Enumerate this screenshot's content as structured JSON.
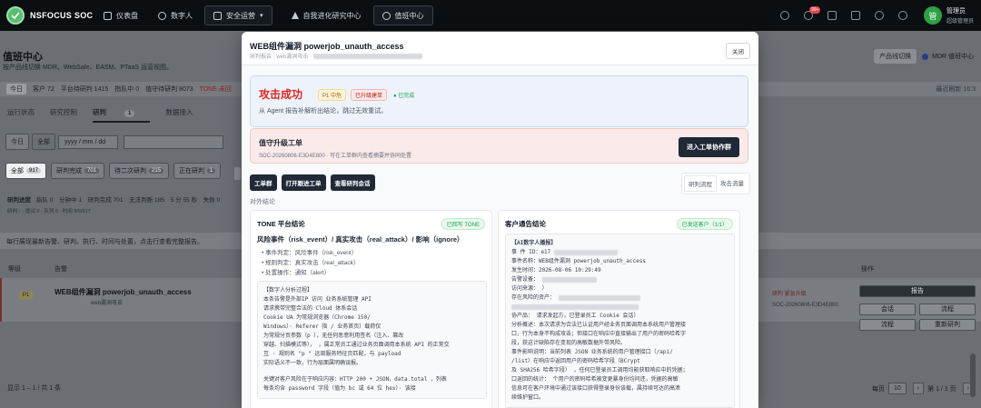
{
  "topbar": {
    "brand": "NSFOCUS SOC",
    "nav": [
      {
        "label": "仪表盘"
      },
      {
        "label": "数字人"
      },
      {
        "label": "安全运营"
      },
      {
        "label": "自我进化研究中心"
      },
      {
        "label": "值班中心"
      }
    ],
    "notification_count": "99+",
    "user_name": "管理员",
    "user_role": "超级管理员",
    "avatar_initial": "管"
  },
  "background": {
    "title": "值班中心",
    "subtitle": "按产品线切换 MDR、WebSafe、EASM、PTaaS 运营视图。",
    "product_switch_label": "产品线切换",
    "product_current": "MDR 值班中心",
    "stats": [
      "今日",
      "客户 72",
      "平台待研判 1415",
      "指队中 0",
      "值守待研判 8073",
      "TONE 未回"
    ],
    "last_refresh": "最近刷新 16:3",
    "tabs": [
      "运行状态",
      "研究控制",
      "研判",
      "数据接入"
    ],
    "tab_pill": "1",
    "filter_today": "今日",
    "filter_all": "全部",
    "date_placeholder": "yyyy / mm / dd",
    "segments": [
      {
        "label": "全部",
        "count": "917"
      },
      {
        "label": "研判完成",
        "count": "701"
      },
      {
        "label": "待二次研判",
        "count": "215"
      },
      {
        "label": "正在研判",
        "count": "1"
      }
    ],
    "progress_label": "研判进度",
    "progress_items": [
      "指队 0",
      "分钟中 1",
      "研判完成 701",
      "无法判断 185",
      "5 分 55 秒",
      "失败 0"
    ],
    "progress_sub": "研判 ↑ : 提试 0 · 队列 0 · 时间 9/6/917",
    "hint": "每行展现最新告警、研判、执行、时间与处置，点击行查看完整报告。",
    "table_headers": [
      "等级",
      "告警",
      "操作"
    ],
    "row": {
      "level": "P1",
      "title": "WEB组件漏洞 powerjob_unauth_access",
      "sub": "web漏洞攻击",
      "tag": "研判 紧急升级",
      "code": "SOC-20260806-E3D4E800"
    },
    "row_actions": [
      "报告",
      "会话",
      "流程",
      "流程",
      "重新研判"
    ],
    "pager_left": "显示 1 – 1 / 共 1 条",
    "pager_label": "每页",
    "page_size": "10",
    "page_info": "第 1 / 1 页"
  },
  "modal": {
    "title": "WEB组件漏洞 powerjob_unauth_access",
    "breadcrumb": "研判报告 · web漏洞攻击 ·",
    "close": "关闭",
    "result_title": "攻击成功",
    "tag_priority": "P1 中危",
    "tag_upgrade": "已升级建单",
    "tag_done": "● 已完成",
    "result_desc": "从 Agent 报告补解析出结论，跳过无效重试。",
    "ticket_title": "值守升级工单",
    "ticket_sub": "SOC-20260806-E3D4E800 · 可在工单群内查看摘要并协同处置",
    "ticket_button": "进入工单协作群",
    "action_buttons": [
      "工单群",
      "打开跟进工单",
      "查看研判会话"
    ],
    "view_tabs": [
      "研判流程",
      "攻击流量"
    ],
    "conclusion_label": "对外结论",
    "tone": {
      "title": "TONE 平台结论",
      "badge": "已回写 TONE",
      "headline": "风险事件（risk_event）/ 真实攻击（real_attack）/ 影响（ignore）",
      "bullets": [
        "事件判定：风险事件（risk_event）",
        "规则判定：真实攻击（real_attack）",
        "处置操作：通知（alert）"
      ],
      "analysis": [
        "【数字人分析过程】",
        "本条告警是外部IP        访问         业务系统管理 API",
        "          请求携带完整合法的          Cloud 体系会话",
        "Cookie          UA 为常规浏览器（Chrome 150/",
        "Windows）· Referer 指           / 业务首页）载荷仅",
        "为常规分页参数（p          ），无任何恶意利用签名（注入、篡改",
        "穿越、扫描模式等），      ，属正常员工通过业务页面调用本系统 API 的正常交",
        "互 · 规则名 \"p          \" 远周服务特征页匹配，与 payload",
        "实际语义不一致，行为层面属明确误报。"
      ],
      "analysis2": [
        "关键对客户风险在于响应内容：HTTP 200 + JSON，data.total         ，列表",
        "每条均含 password 字段（值为 bc           或 64 位 hex）· 该接"
      ]
    },
    "client": {
      "title": "客户通告结论",
      "badge": "已发送客户（1/1）",
      "lines": [
        "【AI数字人播报】",
        "事 件 ID：e17",
        "事件名称：WEB组件漏洞 powerjob_unauth_access",
        "发生时间：2026-08-06 10:29:49",
        "告警设备：",
        "访问来源：                          ）",
        "存在风险的资产：",
        "",
        "协产品：      请求发起方，已登录员工 Cookie 会话）",
        "分析概述：本次请求为合法已认证用户经业务页面调用本系统用户管理接",
        "口，行为本身不构成攻击；但接口在响应中直接输出了用户的密码哈希字",
        "段，获这计缺陷存在变现的高敏数据外带风险。",
        "事件影响说明：当前列表 JSON 业务系统的用户管理接口（/api/",
        "              /list）在响应中返回用户的密码哈希字段（BCrypt",
        "及 SHA256 哈希字段）            ，任何已登录员工调用均能获取响应中的凭据；",
        "口返回的统计：          个用户的密码哈希被变更暴身份均问还，凭据的高敏",
        "信息可在客户环境中通过该接口获得登录身份该载，属持续可达的高泄",
        "续维护窗口。"
      ]
    }
  }
}
